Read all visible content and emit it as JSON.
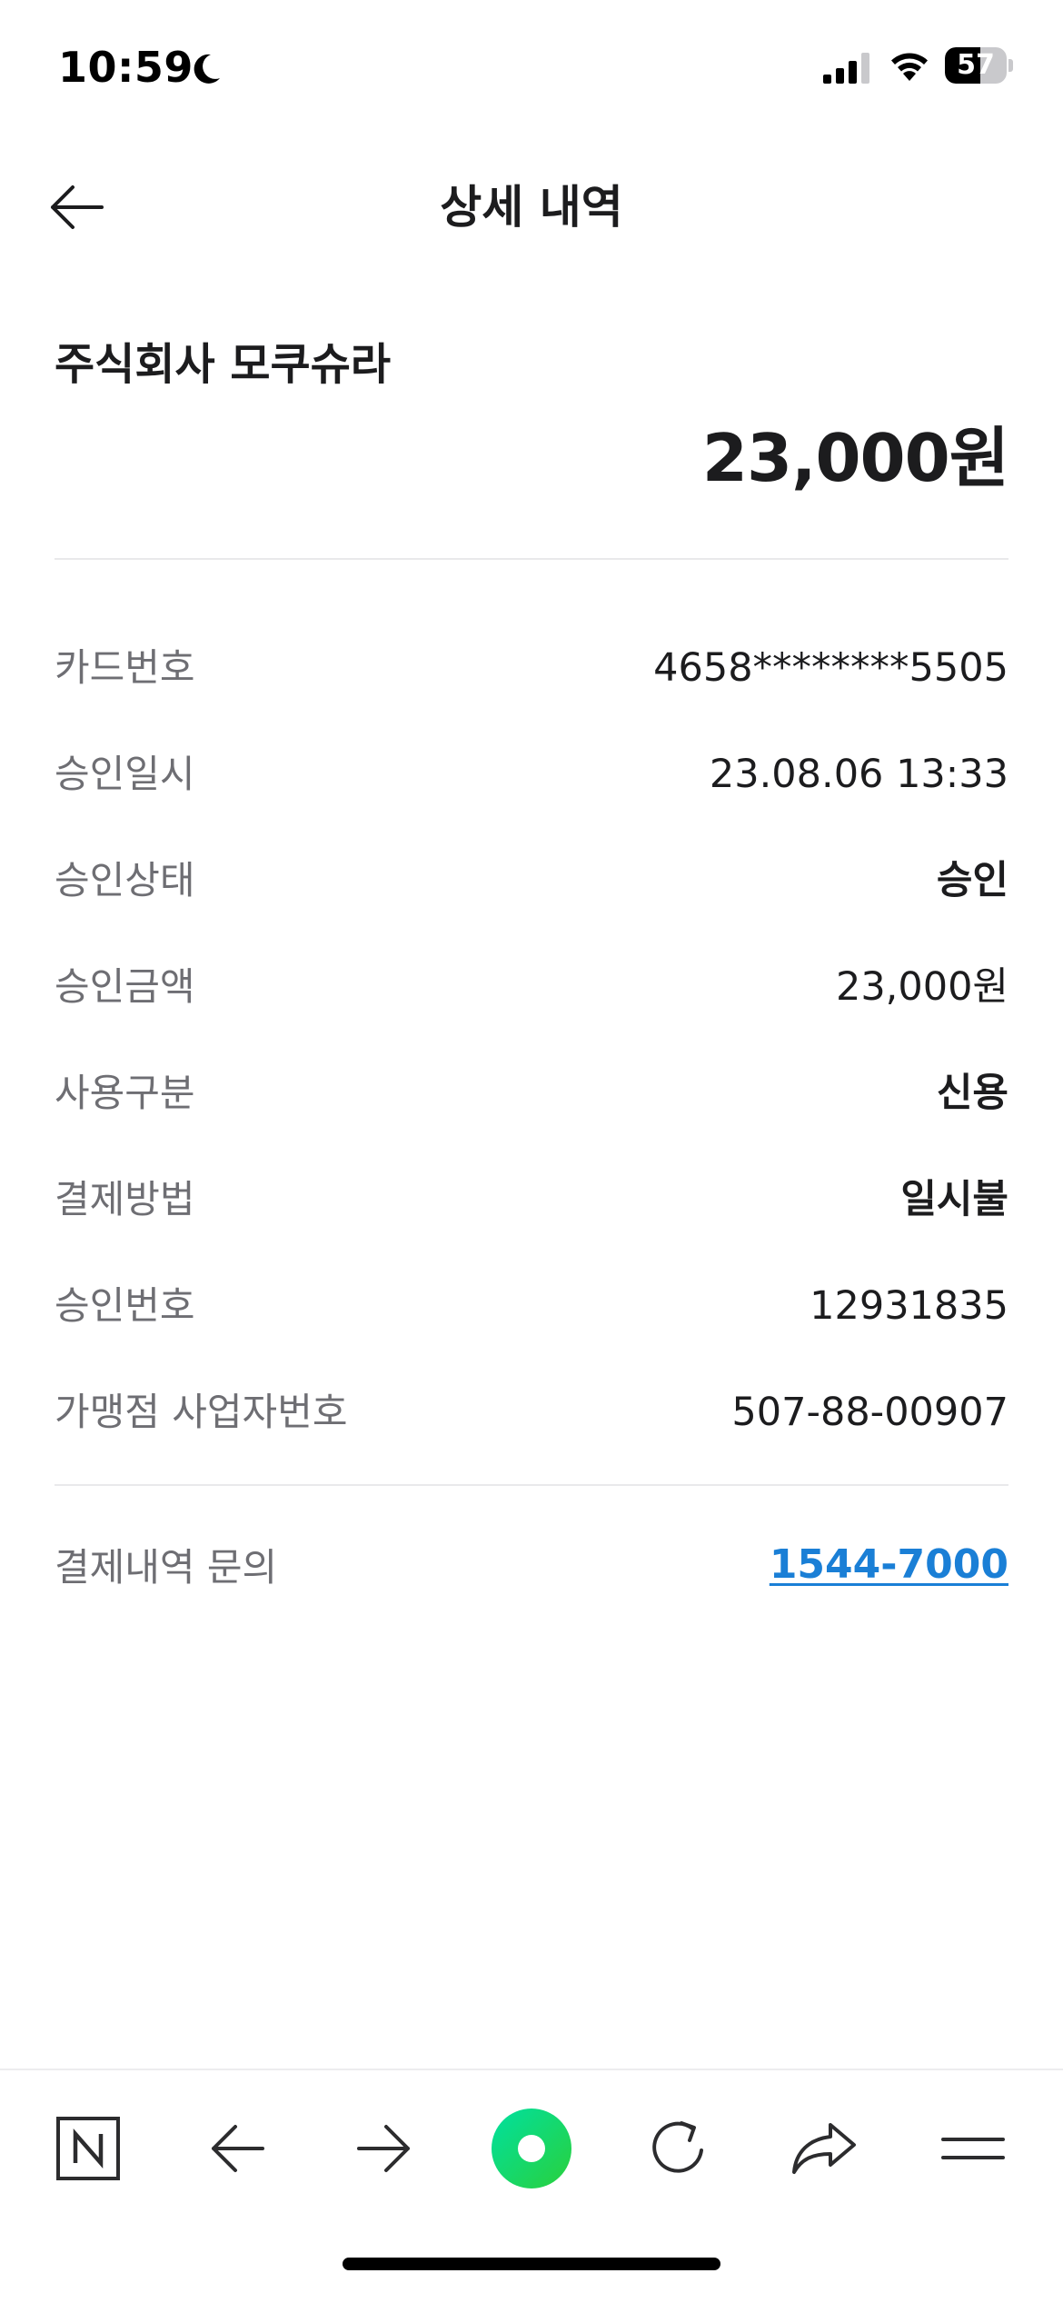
{
  "status_bar": {
    "time": "10:59",
    "battery_level": "57",
    "battery_fraction": 0.57
  },
  "header": {
    "title": "상세 내역",
    "back_icon": "arrow-left-icon"
  },
  "merchant": {
    "name": "주식회사 모쿠슈라",
    "amount": "23,000원"
  },
  "details": [
    {
      "label": "카드번호",
      "value": "4658********5505",
      "bold": false
    },
    {
      "label": "승인일시",
      "value": "23.08.06 13:33",
      "bold": false
    },
    {
      "label": "승인상태",
      "value": "승인",
      "bold": true
    },
    {
      "label": "승인금액",
      "value": "23,000원",
      "bold": false
    },
    {
      "label": "사용구분",
      "value": "신용",
      "bold": true
    },
    {
      "label": "결제방법",
      "value": "일시불",
      "bold": true
    },
    {
      "label": "승인번호",
      "value": "12931835",
      "bold": false
    },
    {
      "label": "가맹점 사업자번호",
      "value": "507-88-00907",
      "bold": false
    }
  ],
  "inquiry": {
    "label": "결제내역 문의",
    "phone": "1544-7000"
  },
  "toolbar": {
    "items": [
      "naver-logo-icon",
      "back-arrow-icon",
      "forward-arrow-icon",
      "green-dot-icon",
      "refresh-icon",
      "share-icon",
      "menu-icon"
    ]
  },
  "colors": {
    "link": "#1a7fd6",
    "label_gray": "#6e6e73",
    "text_dark": "#1c1c1e",
    "green_start": "#00e0a0",
    "green_end": "#2ad03b"
  }
}
